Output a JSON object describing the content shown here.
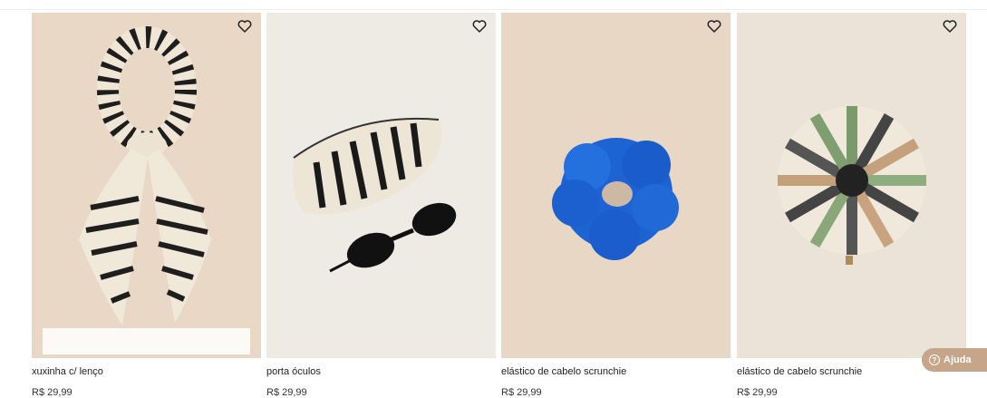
{
  "products": [
    {
      "name": "xuxinha c/ lenço",
      "price": "R$ 29,99"
    },
    {
      "name": "porta óculos",
      "price": "R$ 29,99"
    },
    {
      "name": "elástico de cabelo scrunchie",
      "price": "R$ 29,99"
    },
    {
      "name": "elástico de cabelo scrunchie",
      "price": "R$ 29,99"
    }
  ],
  "help": {
    "label": "Ajuda",
    "icon": "?"
  },
  "icons": {
    "favorite": "heart-outline-icon"
  },
  "colors": {
    "help_bg": "#c6a58a",
    "linen_bg": "#e7d7c6",
    "light_bg": "#eeeae4",
    "blue_scrunchie": "#1e63d3"
  }
}
